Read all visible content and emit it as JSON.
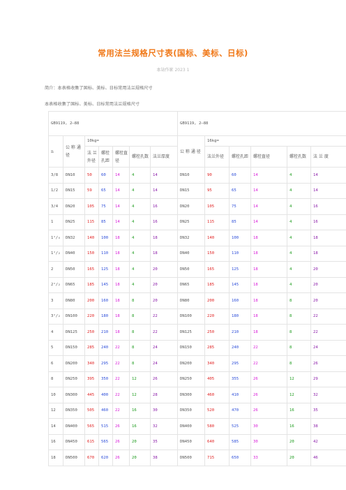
{
  "document": {
    "title": "常用法兰规格尺寸表(国标、美标、日标)",
    "meta": "本站作家 2023 1",
    "intro1": "简介：本表格收集了国标、美标、日标常用法兰规格尺寸",
    "intro2": "本表格收集了国标、美标、日标常用法兰规格尺寸"
  },
  "table": {
    "std_left": "GB9119, 2—88",
    "std_right": "GB9119, 2—88",
    "grade_left": "10kg=",
    "grade_right": "16kg=",
    "n_label": "n",
    "dn_label": "公 称 通 径",
    "headers_left": [
      "法 兰 外径",
      "螺栓孔距",
      "螺栓直径",
      "螺栓孔数",
      "法兰厚度"
    ],
    "headers_right": [
      "法兰外径",
      "螺栓孔距",
      "螺栓直径",
      "螺栓孔数",
      "法 兰 度"
    ],
    "rows": [
      [
        "3/8",
        "DN10",
        "50",
        "60",
        "14",
        "4",
        "14",
        "DN10",
        "90",
        "60",
        "14",
        "4",
        "14"
      ],
      [
        "1/2",
        "DN15",
        "59",
        "65",
        "14",
        "4",
        "14",
        "DN15",
        "95",
        "65",
        "14",
        "4",
        "14"
      ],
      [
        "3/4",
        "DN20",
        "105",
        "75",
        "14",
        "4",
        "16",
        "DN20",
        "105",
        "75",
        "14",
        "4",
        "16"
      ],
      [
        "1",
        "DN25",
        "115",
        "85",
        "14",
        "4",
        "16",
        "DN25",
        "115",
        "85",
        "14",
        "4",
        "16"
      ],
      [
        "1¹/₄",
        "DN32",
        "140",
        "100",
        "18",
        "4",
        "18",
        "DN32",
        "140",
        "100",
        "18",
        "4",
        "18"
      ],
      [
        "1¹/₂",
        "DN40",
        "150",
        "110",
        "18",
        "4",
        "18",
        "DN40",
        "150",
        "110",
        "18",
        "4",
        "18"
      ],
      [
        "2",
        "DN50",
        "165",
        "125",
        "18",
        "4",
        "20",
        "DN50",
        "165",
        "125",
        "18",
        "4",
        "20"
      ],
      [
        "2¹/₂",
        "DN65",
        "185",
        "145",
        "18",
        "4",
        "20",
        "DN65",
        "185",
        "145",
        "18",
        "4",
        "20"
      ],
      [
        "3",
        "DN80",
        "200",
        "160",
        "18",
        "8",
        "20",
        "DN80",
        "200",
        "160",
        "18",
        "8",
        "20"
      ],
      [
        "3¹/₂",
        "DN100",
        "220",
        "180",
        "18",
        "8",
        "22",
        "DN100",
        "220",
        "180",
        "18",
        "8",
        "22"
      ],
      [
        "4",
        "DN125",
        "250",
        "210",
        "18",
        "8",
        "22",
        "DN125",
        "250",
        "210",
        "18",
        "8",
        "22"
      ],
      [
        "5",
        "DN150",
        "285",
        "240",
        "22",
        "8",
        "24",
        "DN150",
        "285",
        "240",
        "22",
        "8",
        "24"
      ],
      [
        "6",
        "DN200",
        "340",
        "295",
        "22",
        "8",
        "24",
        "DN200",
        "340",
        "295",
        "22",
        "8",
        "26"
      ],
      [
        "8",
        "DN250",
        "395",
        "350",
        "22",
        "12",
        "26",
        "DN250",
        "405",
        "355",
        "26",
        "12",
        "29"
      ],
      [
        "10",
        "DN300",
        "445",
        "400",
        "22",
        "12",
        "28",
        "DN300",
        "460",
        "410",
        "26",
        "12",
        "32"
      ],
      [
        "12",
        "DN350",
        "505",
        "460",
        "22",
        "16",
        "30",
        "DN350",
        "520",
        "470",
        "26",
        "16",
        "35"
      ],
      [
        "14",
        "DN400",
        "565",
        "515",
        "26",
        "16",
        "32",
        "DN400",
        "580",
        "525",
        "30",
        "16",
        "38"
      ],
      [
        "16",
        "DN450",
        "615",
        "565",
        "26",
        "20",
        "35",
        "DN450",
        "640",
        "585",
        "30",
        "20",
        "42"
      ],
      [
        "18",
        "DN500",
        "670",
        "620",
        "26",
        "20",
        "38",
        "DN500",
        "715",
        "650",
        "33",
        "20",
        "46"
      ]
    ]
  },
  "colors": {
    "title": "#f07818",
    "outer_diameter": "#e02020",
    "bolt_circle": "#2a4bd8",
    "bolt_diameter": "#d81ad8",
    "bolt_count": "#1a9a1a",
    "thickness": "#8a1aa8"
  }
}
